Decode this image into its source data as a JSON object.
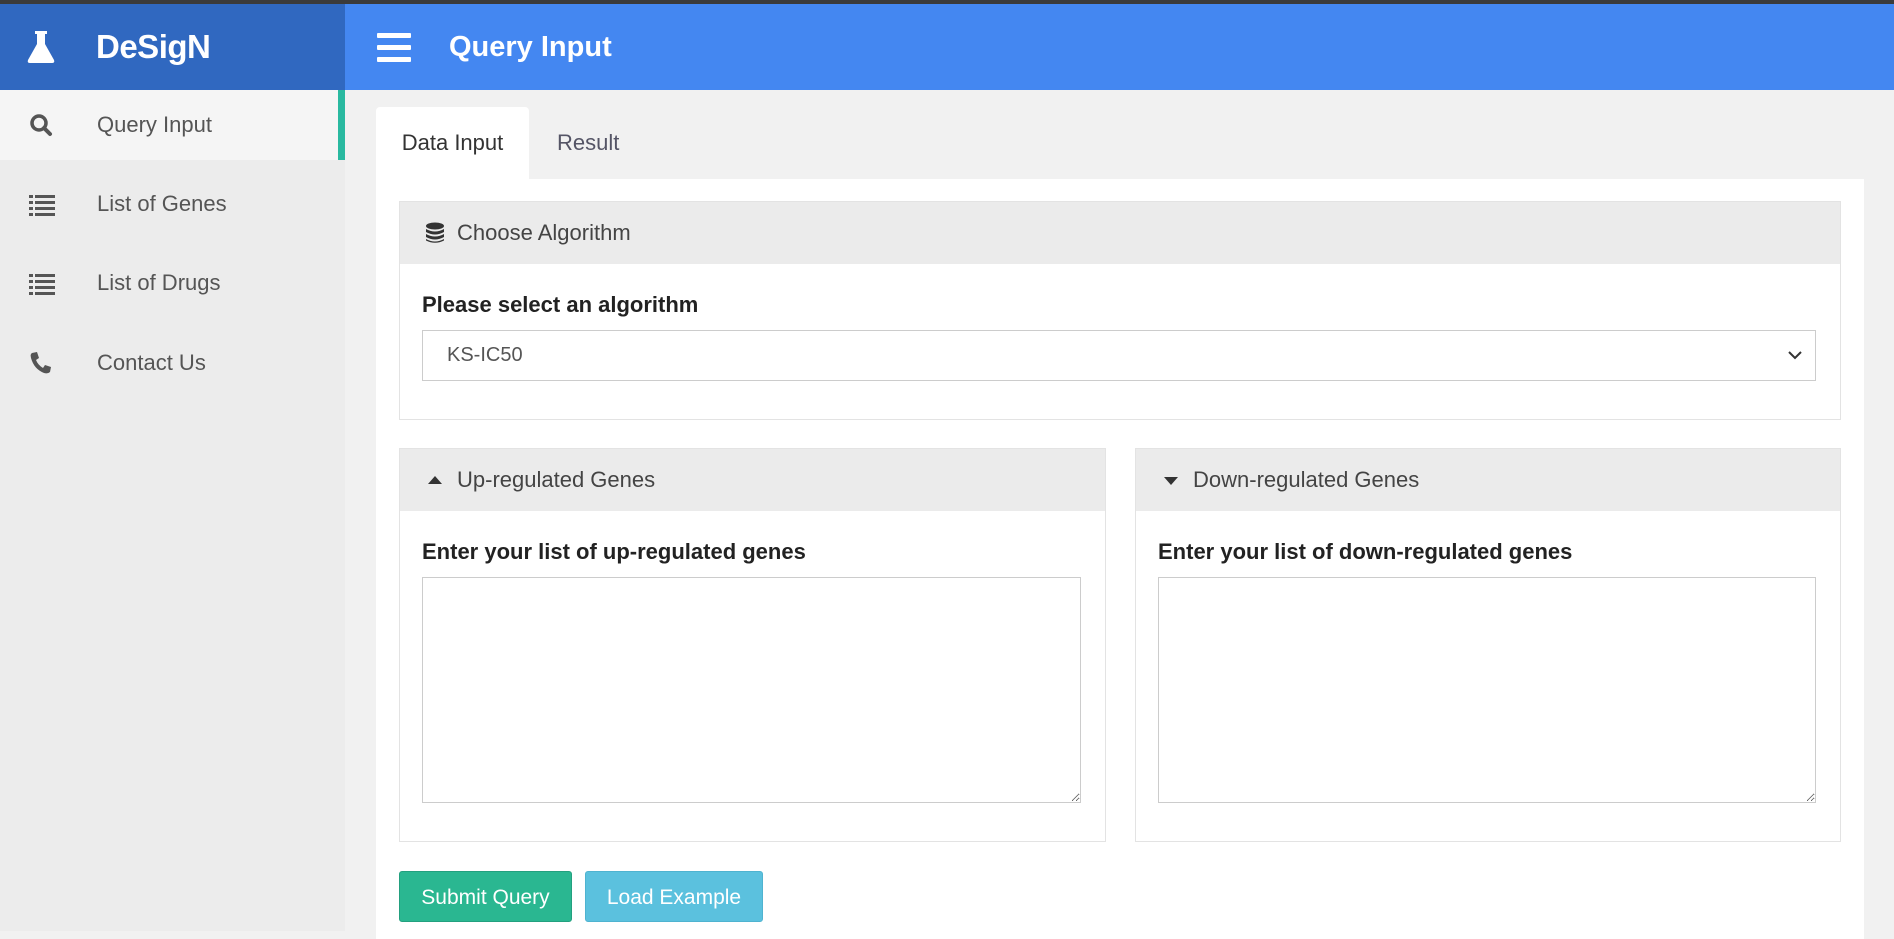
{
  "app": {
    "brand": "DeSigN"
  },
  "header": {
    "title": "Query Input"
  },
  "sidebar": {
    "items": [
      {
        "label": "Query Input",
        "icon": "search-icon",
        "active": true
      },
      {
        "label": "List of Genes",
        "icon": "list-icon",
        "active": false
      },
      {
        "label": "List of Drugs",
        "icon": "list-icon",
        "active": false
      },
      {
        "label": "Contact Us",
        "icon": "phone-icon",
        "active": false
      }
    ]
  },
  "tabs": [
    {
      "label": "Data Input",
      "active": true
    },
    {
      "label": "Result",
      "active": false
    }
  ],
  "algorithm_box": {
    "title": "Choose Algorithm",
    "icon": "database-icon",
    "field_label": "Please select an algorithm",
    "selected": "KS-IC50"
  },
  "up_box": {
    "title": "Up-regulated Genes",
    "icon": "caret-up-icon",
    "field_label": "Enter your list of up-regulated genes",
    "value": ""
  },
  "down_box": {
    "title": "Down-regulated Genes",
    "icon": "caret-down-icon",
    "field_label": "Enter your list of down-regulated genes",
    "value": ""
  },
  "buttons": {
    "submit": "Submit Query",
    "example": "Load Example"
  },
  "colors": {
    "header": "#4487f1",
    "logo_bar": "#3068c0",
    "sidebar_active_indicator": "#29b9a0",
    "submit_button": "#2ab791",
    "example_button": "#5bc1de"
  }
}
